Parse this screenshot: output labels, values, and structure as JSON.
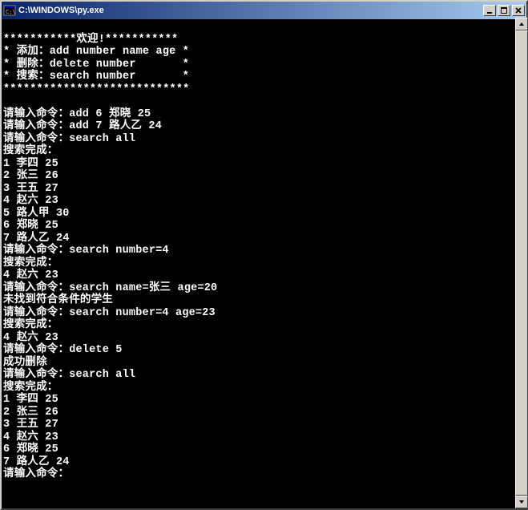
{
  "window": {
    "title": "C:\\WINDOWS\\py.exe"
  },
  "console": {
    "lines": [
      "",
      "***********欢迎!***********",
      "* 添加：add number name age *",
      "* 删除：delete number       *",
      "* 搜索：search number       *",
      "****************************",
      "",
      "请输入命令：add 6 郑晓 25",
      "请输入命令：add 7 路人乙 24",
      "请输入命令：search all",
      "搜索完成：",
      "1 李四 25",
      "2 张三 26",
      "3 王五 27",
      "4 赵六 23",
      "5 路人甲 30",
      "6 郑晓 25",
      "7 路人乙 24",
      "请输入命令：search number=4",
      "搜索完成：",
      "4 赵六 23",
      "请输入命令：search name=张三 age=20",
      "未找到符合条件的学生",
      "请输入命令：search number=4 age=23",
      "搜索完成：",
      "4 赵六 23",
      "请输入命令：delete 5",
      "成功删除",
      "请输入命令：search all",
      "搜索完成：",
      "1 李四 25",
      "2 张三 26",
      "3 王五 27",
      "4 赵六 23",
      "6 郑晓 25",
      "7 路人乙 24",
      "请输入命令："
    ]
  }
}
